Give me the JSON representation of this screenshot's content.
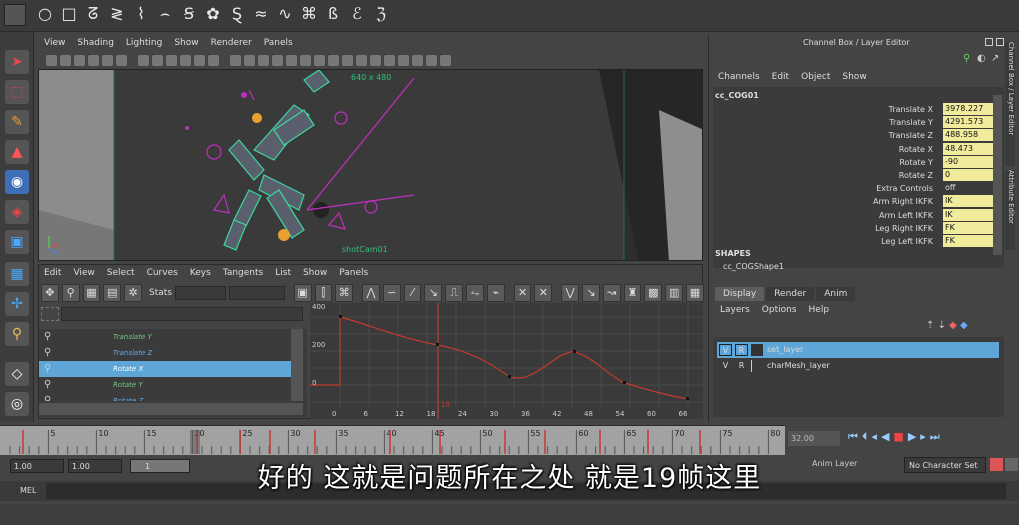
{
  "viewport": {
    "menu": [
      "View",
      "Shading",
      "Lighting",
      "Show",
      "Renderer",
      "Panels"
    ],
    "resolution_label": "640 x 480",
    "camera_label": "shotCam01"
  },
  "graph_editor": {
    "menu": [
      "Edit",
      "View",
      "Select",
      "Curves",
      "Keys",
      "Tangents",
      "List",
      "Show",
      "Panels"
    ],
    "stats_label": "Stats",
    "outliner_rows": [
      "Translate Y",
      "Translate Z",
      "Rotate X",
      "Rotate Y",
      "Rotate Z"
    ],
    "selected_row": 2,
    "y_ticks": [
      "400",
      "200",
      "0"
    ],
    "x_ticks": [
      "0",
      "6",
      "12",
      "18",
      "24",
      "30",
      "36",
      "42",
      "48",
      "54",
      "60",
      "66"
    ],
    "current_frame_marker": "19"
  },
  "channel_box": {
    "title": "Channel Box / Layer Editor",
    "menu": [
      "Channels",
      "Edit",
      "Object",
      "Show"
    ],
    "object_name": "cc_COG01",
    "attributes": [
      {
        "name": "Translate X",
        "value": "3978.227"
      },
      {
        "name": "Translate Y",
        "value": "4291.573"
      },
      {
        "name": "Translate Z",
        "value": "488.958"
      },
      {
        "name": "Rotate X",
        "value": "48.473"
      },
      {
        "name": "Rotate Y",
        "value": "-90"
      },
      {
        "name": "Rotate Z",
        "value": "0"
      },
      {
        "name": "Extra Controls",
        "value": "off"
      },
      {
        "name": "Arm Right IKFK",
        "value": "IK"
      },
      {
        "name": "Arm Left IKFK",
        "value": "IK"
      },
      {
        "name": "Leg Right IKFK",
        "value": "FK"
      },
      {
        "name": "Leg Left IKFK",
        "value": "FK"
      }
    ],
    "shapes_label": "SHAPES",
    "shape_name": "cc_COGShape1",
    "side_tabs": [
      "Channel Box / Layer Editor",
      "Attribute Editor"
    ]
  },
  "layer_editor": {
    "tabs": [
      "Display",
      "Render",
      "Anim"
    ],
    "menu": [
      "Layers",
      "Options",
      "Help"
    ],
    "layers": [
      {
        "v": "V",
        "r": "R",
        "name": "set_layer"
      },
      {
        "v": "V",
        "r": "R",
        "name": "charMesh_layer"
      }
    ]
  },
  "timeline": {
    "ticks": [
      "5",
      "10",
      "15",
      "20",
      "25",
      "30",
      "35",
      "40",
      "45",
      "50",
      "55",
      "60",
      "65",
      "70",
      "75",
      "80"
    ],
    "current_time": "32.00",
    "range_start": "1.00",
    "range_start2": "1.00",
    "range_field": "1",
    "anim_layer": "Anim Layer",
    "character_set": "No Character Set"
  },
  "mel_label": "MEL",
  "subtitle": "好的  这就是问题所在之处  就是19帧这里",
  "colors": {
    "selected_row": "#5ea5d8",
    "attr_field": "#f1ec9b",
    "curve": "#c43a2e",
    "rig": "#3cd6a0",
    "control": "#c030c0"
  }
}
